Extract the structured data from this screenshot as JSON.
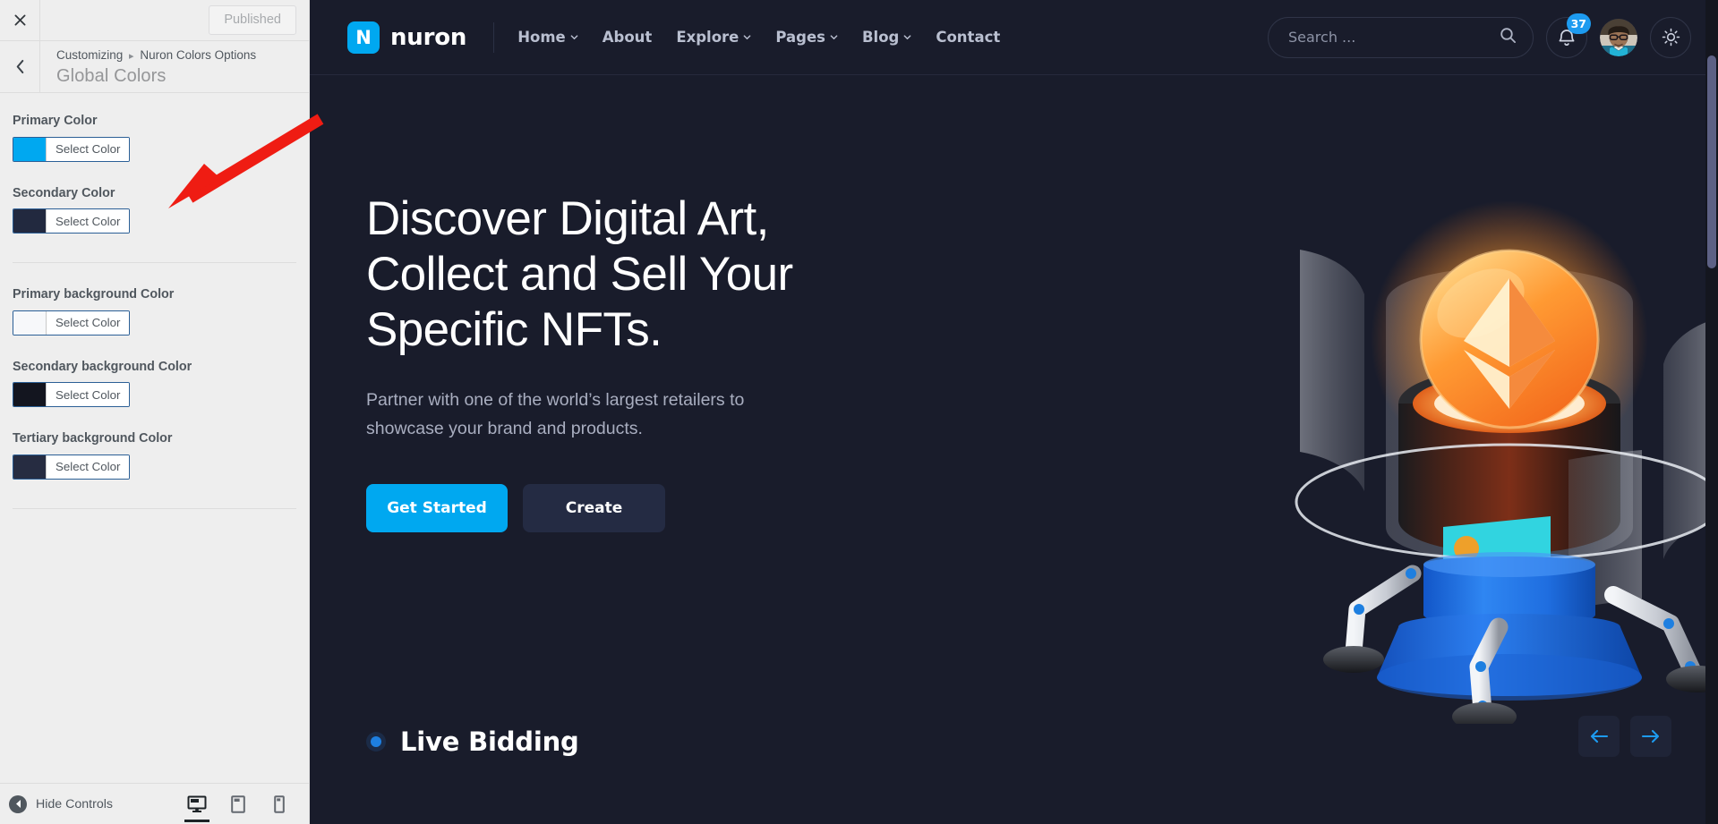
{
  "customizer": {
    "close_icon": "close-icon",
    "published_label": "Published",
    "back_icon": "chevron-left-icon",
    "breadcrumb_root": "Customizing",
    "breadcrumb_sep": "▸",
    "breadcrumb_current": "Nuron Colors Options",
    "section_title": "Global Colors",
    "controls": [
      {
        "label": "Primary Color",
        "button": "Select Color",
        "value": "#00a8f0"
      },
      {
        "label": "Secondary Color",
        "button": "Select Color",
        "value": "#22293f"
      },
      {
        "label": "Primary background Color",
        "button": "Select Color",
        "value": "#f7f8fa"
      },
      {
        "label": "Secondary background Color",
        "button": "Select Color",
        "value": "#13151f"
      },
      {
        "label": "Tertiary background Color",
        "button": "Select Color",
        "value": "#262c41"
      }
    ],
    "footer": {
      "hide_controls_label": "Hide Controls",
      "devices": [
        {
          "name": "desktop",
          "active": true
        },
        {
          "name": "tablet",
          "active": false
        },
        {
          "name": "mobile",
          "active": false
        }
      ]
    }
  },
  "site": {
    "brand": {
      "mark": "N",
      "name": "nuron",
      "accent": "#00a8f0"
    },
    "nav": [
      {
        "label": "Home",
        "caret": true
      },
      {
        "label": "About",
        "caret": false
      },
      {
        "label": "Explore",
        "caret": true
      },
      {
        "label": "Pages",
        "caret": true
      },
      {
        "label": "Blog",
        "caret": true
      },
      {
        "label": "Contact",
        "caret": false
      }
    ],
    "search": {
      "placeholder": "Search ...",
      "value": "",
      "icon": "search-icon"
    },
    "notifications": {
      "icon": "bell-icon",
      "count": "37",
      "badge_color": "#1d9bf0"
    },
    "avatar": {
      "icon": "user-avatar"
    },
    "theme_toggle": {
      "icon": "sun-icon"
    },
    "hero": {
      "title_lines": [
        "Discover Digital Art,",
        "Collect and Sell Your",
        "Specific NFTs."
      ],
      "subtitle_lines": [
        "Partner with one of the world’s largest retailers to",
        "showcase your brand and products."
      ],
      "primary_button": "Get Started",
      "secondary_button": "Create",
      "artwork": "ethereum-coin-robot-illustration"
    },
    "live_bidding": {
      "title": "Live Bidding",
      "dot_color": "#1e7fe0"
    },
    "slider_nav": {
      "prev_icon": "arrow-left-icon",
      "next_icon": "arrow-right-icon",
      "accent": "#1d9bf0"
    },
    "colors": {
      "background": "#191c2b",
      "header_border": "#262a3c",
      "text": "#ffffff",
      "muted_text": "#a9aec0",
      "accent": "#00a8f0",
      "secondary_button": "#242b43"
    }
  },
  "annotation": {
    "type": "arrow",
    "color": "#ef1c13",
    "points_to": "secondary-color-control"
  }
}
